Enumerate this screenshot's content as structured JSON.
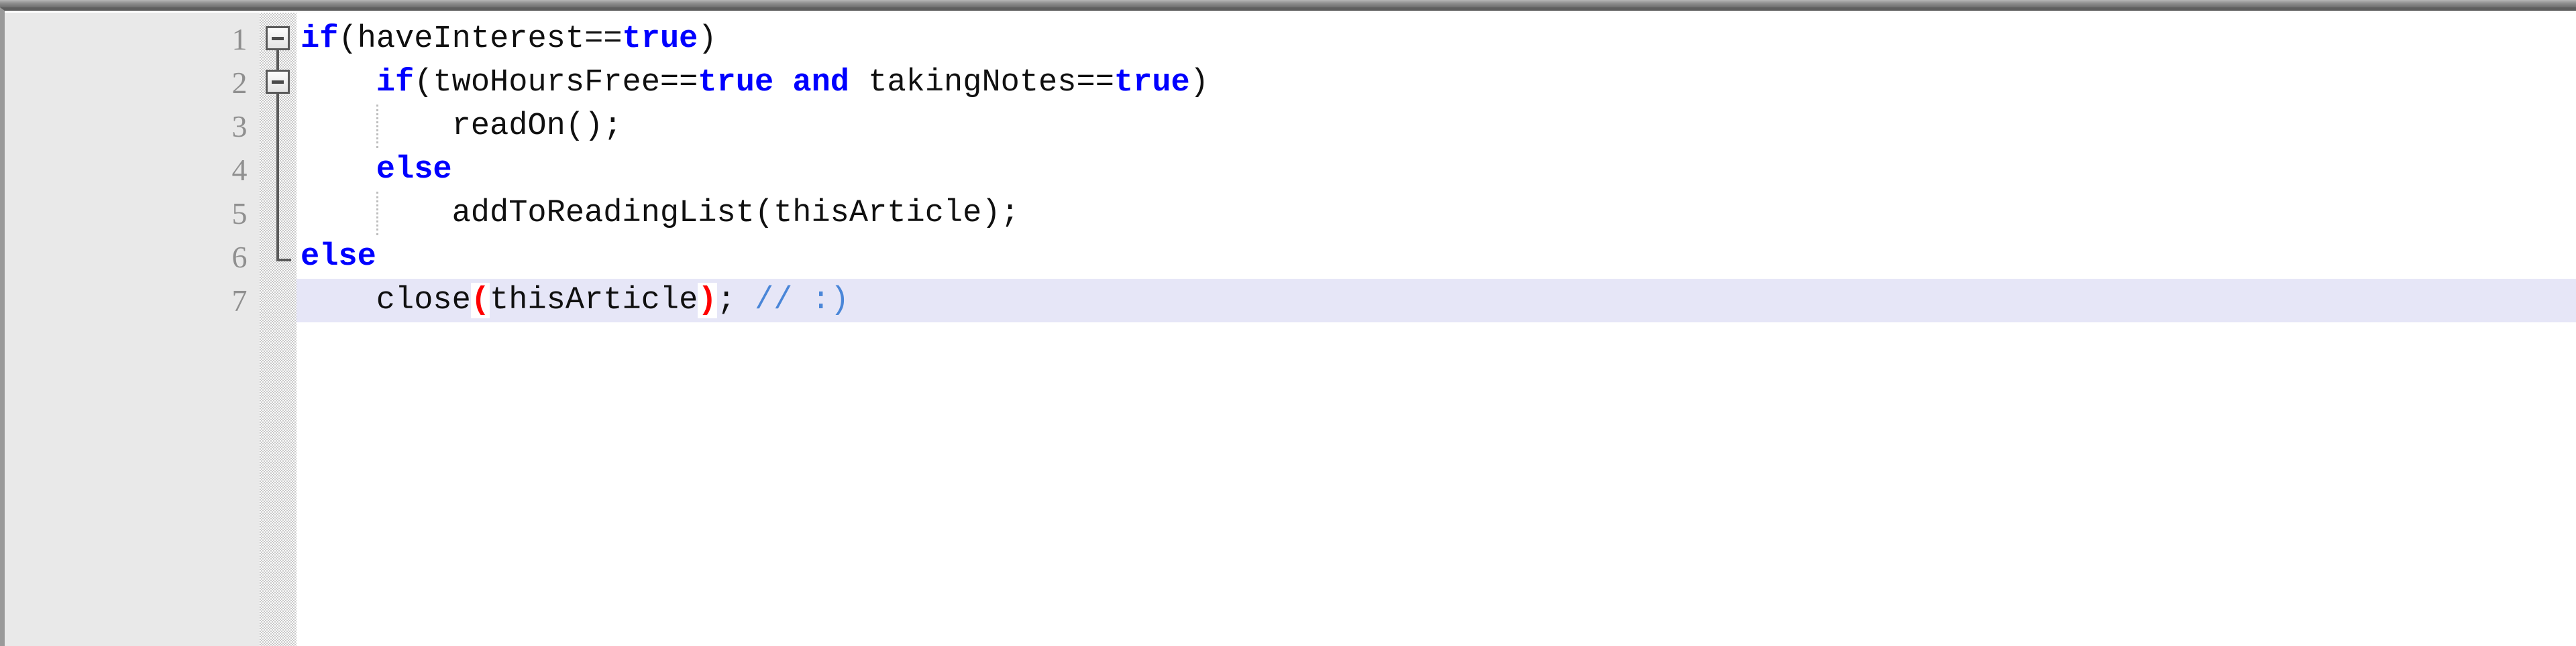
{
  "editor": {
    "kind": "code-editor-pane",
    "language_hint": "pseudocode",
    "current_line": 7,
    "colors": {
      "background": "#ffffff",
      "gutter_background": "#e9e9e9",
      "line_number": "#8f8f8f",
      "keyword": "#0000ff",
      "identifier": "#101010",
      "comment": "#4a86d8",
      "matching_bracket": "#ff0000",
      "current_line_highlight": "#e6e6f7",
      "fold_marker": "#5a5a5a",
      "window_titlebar": "#8d8d8d"
    },
    "line_numbers": [
      "1",
      "2",
      "3",
      "4",
      "5",
      "6",
      "7"
    ],
    "lines": [
      {
        "number": "1",
        "indent": 0,
        "folded": false,
        "fold_marker": "collapse",
        "tokens": [
          {
            "text": "if",
            "type": "keyword"
          },
          {
            "text": "(",
            "type": "plain"
          },
          {
            "text": "haveInterest",
            "type": "plain"
          },
          {
            "text": "==",
            "type": "operator"
          },
          {
            "text": "true",
            "type": "keyword"
          },
          {
            "text": ")",
            "type": "plain"
          }
        ],
        "plain_text": "if(haveInterest==true)"
      },
      {
        "number": "2",
        "indent": 1,
        "folded": false,
        "fold_marker": "collapse",
        "tokens": [
          {
            "text": "if",
            "type": "keyword"
          },
          {
            "text": "(",
            "type": "plain"
          },
          {
            "text": "twoHoursFree",
            "type": "plain"
          },
          {
            "text": "==",
            "type": "operator"
          },
          {
            "text": "true",
            "type": "keyword"
          },
          {
            "text": " ",
            "type": "plain"
          },
          {
            "text": "and",
            "type": "keyword"
          },
          {
            "text": " ",
            "type": "plain"
          },
          {
            "text": "takingNotes",
            "type": "plain"
          },
          {
            "text": "==",
            "type": "operator"
          },
          {
            "text": "true",
            "type": "keyword"
          },
          {
            "text": ")",
            "type": "plain"
          }
        ],
        "plain_text": "    if(twoHoursFree==true and takingNotes==true)"
      },
      {
        "number": "3",
        "indent": 2,
        "folded": false,
        "fold_marker": "none",
        "tokens": [
          {
            "text": "readOn();",
            "type": "plain"
          }
        ],
        "plain_text": "        readOn();"
      },
      {
        "number": "4",
        "indent": 1,
        "folded": false,
        "fold_marker": "none",
        "tokens": [
          {
            "text": "else",
            "type": "keyword"
          }
        ],
        "plain_text": "    else"
      },
      {
        "number": "5",
        "indent": 2,
        "folded": false,
        "fold_marker": "none",
        "tokens": [
          {
            "text": "addToReadingList(thisArticle);",
            "type": "plain"
          }
        ],
        "plain_text": "        addToReadingList(thisArticle);"
      },
      {
        "number": "6",
        "indent": 0,
        "folded": false,
        "fold_marker": "end",
        "tokens": [
          {
            "text": "else",
            "type": "keyword"
          }
        ],
        "plain_text": "else"
      },
      {
        "number": "7",
        "indent": 1,
        "folded": false,
        "fold_marker": "none",
        "current": true,
        "tokens": [
          {
            "text": "close",
            "type": "plain"
          },
          {
            "text": "(",
            "type": "bracket-match"
          },
          {
            "text": "thisArticle",
            "type": "plain"
          },
          {
            "text": ")",
            "type": "bracket-match"
          },
          {
            "text": ";",
            "type": "plain"
          },
          {
            "text": " ",
            "type": "plain"
          },
          {
            "text": "// :)",
            "type": "comment"
          }
        ],
        "plain_text": "    close(thisArticle); // :)"
      }
    ]
  }
}
